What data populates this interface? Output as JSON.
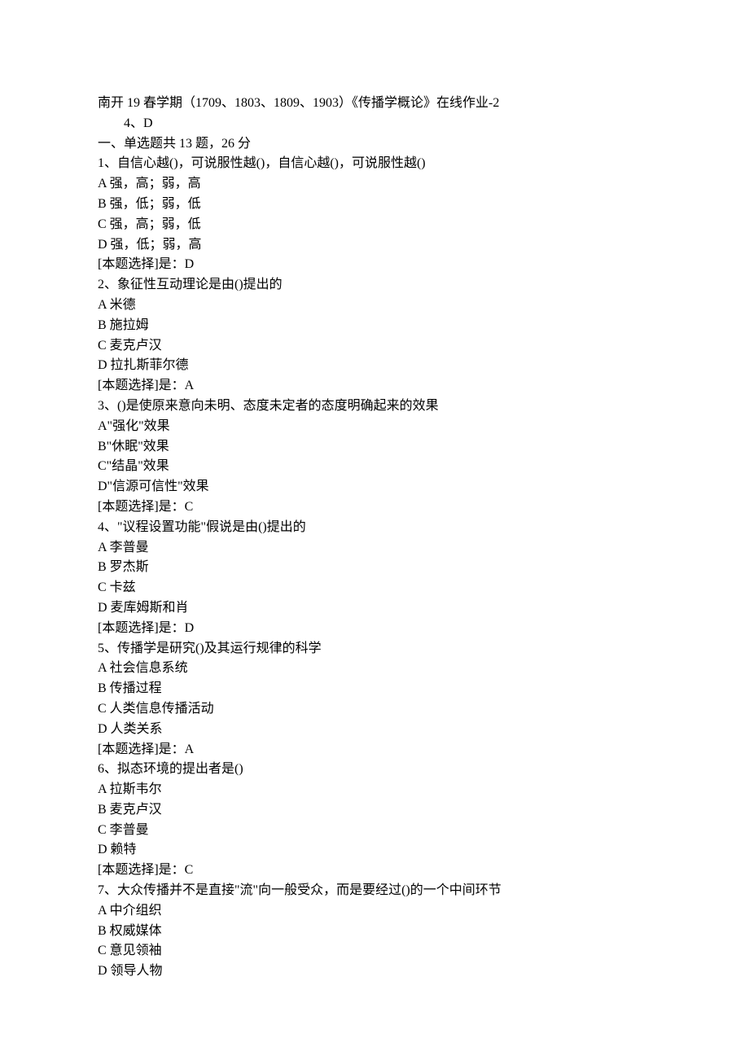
{
  "header": {
    "title": "南开 19 春学期（1709、1803、1809、1903）《传播学概论》在线作业-2",
    "sub": "4、D"
  },
  "section": {
    "title": "一、单选题共 13 题，26 分"
  },
  "questions": [
    {
      "stem": "1、自信心越()，可说服性越()，自信心越()，可说服性越()",
      "options": [
        "A 强，高；弱，高",
        "B 强，低；弱，低",
        "C 强，高；弱，低",
        "D 强，低；弱，高"
      ],
      "answer": "[本题选择]是：D"
    },
    {
      "stem": "2、象征性互动理论是由()提出的",
      "options": [
        "A 米德",
        "B 施拉姆",
        "C 麦克卢汉",
        "D 拉扎斯菲尔德"
      ],
      "answer": "[本题选择]是：A"
    },
    {
      "stem": "3、()是使原来意向未明、态度未定者的态度明确起来的效果",
      "options": [
        "A\"强化\"效果",
        "B\"休眠\"效果",
        "C\"结晶\"效果",
        "D\"信源可信性\"效果"
      ],
      "answer": "[本题选择]是：C"
    },
    {
      "stem": "4、\"议程设置功能\"假说是由()提出的",
      "options": [
        "A 李普曼",
        "B 罗杰斯",
        "C 卡兹",
        "D 麦库姆斯和肖"
      ],
      "answer": "[本题选择]是：D"
    },
    {
      "stem": "5、传播学是研究()及其运行规律的科学",
      "options": [
        "A 社会信息系统",
        "B 传播过程",
        "C 人类信息传播活动",
        "D 人类关系"
      ],
      "answer": "[本题选择]是：A"
    },
    {
      "stem": "6、拟态环境的提出者是()",
      "options": [
        "A 拉斯韦尔",
        "B 麦克卢汉",
        "C 李普曼",
        "D 赖特"
      ],
      "answer": "[本题选择]是：C"
    },
    {
      "stem": "7、大众传播并不是直接\"流\"向一般受众，而是要经过()的一个中间环节",
      "options": [
        "A 中介组织",
        "B 权威媒体",
        "C 意见领袖",
        "D 领导人物"
      ],
      "answer": null
    }
  ]
}
